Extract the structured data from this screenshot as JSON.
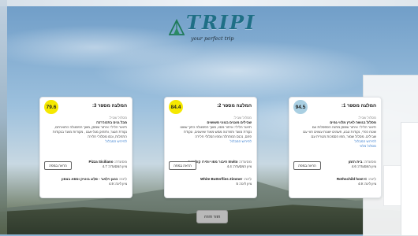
{
  "brand": {
    "name": "TRIPI",
    "tagline": "your perfect trip"
  },
  "recommendations": [
    {
      "title": "המלצה מספר 1:",
      "score": "94.5",
      "score_color": "#a9cfe2",
      "lines": [
        "מסלול שביל:",
        "מסלול בגושה לארץ מלווי גמים",
        "תיאור הלילי: איתור שמסן מתנה הספסלות עם",
        "שטח כפרי, נקודות טבע, פעמים ישנות עשוים חווי עם",
        "שבילים. מסלול שמור, מפו הסמכות מטרית עם",
        "לפירוש המבלול"
      ],
      "link": "מסלול מלווי",
      "places": [
        {
          "label": "מסעדה:",
          "name": "בית הזמן",
          "rating": "ציון המסעדה: 4.6"
        },
        {
          "label": "לינה:",
          "name": "Rothschild host C",
          "rating": "ציון לינה: 4.9"
        }
      ],
      "button": "הראה במפה"
    },
    {
      "title": "המלצה מספר 2:",
      "score": "84.4",
      "score_color": "#f5e800",
      "lines": [
        "מסלול שביל:",
        "שבילים מוגנים בגווני משושים",
        "תיאור הלילי: איתור מסוו, משך הפסגולה כתוך ששנו",
        "נקודת מועד ותפרטה ממש מאוד שיושנים, ונקודת",
        "פחם, נכנס המתחלה ומפו הסלולי חלירה"
      ],
      "link": "לפירוש המבלול",
      "places": [
        {
          "label": "מסעדה:",
          "name": "Invito חיבור מפו יותירו קולינאר",
          "rating": "ציון המסעדה: 4.4"
        },
        {
          "label": "לינה:",
          "name": "White Butterflies Zimmer",
          "rating": "ציון לינה: 5"
        }
      ],
      "button": "הראה במפה"
    },
    {
      "title": "המלצה מספר 3:",
      "score": "79.6",
      "score_color": "#f5e800",
      "lines": [
        "מסלול שביל:",
        "מבל גנים בתכונ'רכה",
        "תיאור הלילי: איתור שמסן, משך הפסגולה כתוארתם,",
        "נקודת חנצר, ותזחוק מגל-אגם , מקודות מועד בנקודות",
        "התחלות, ונסו מסלולי חלירה"
      ],
      "link": "לפירוש המבלול",
      "places": [
        {
          "label": "מסעדה:",
          "name": "Pizza Siciliano",
          "rating": "ציון המסעדה: 4.7"
        },
        {
          "label": "לינה:",
          "name": "כנען וילאג' - פלוג בוטיק וספא בצפון",
          "rating": "ציון לינה: 4.9"
        }
      ],
      "button": "הראה במפה"
    }
  ],
  "back_button": "חזור חזרה"
}
